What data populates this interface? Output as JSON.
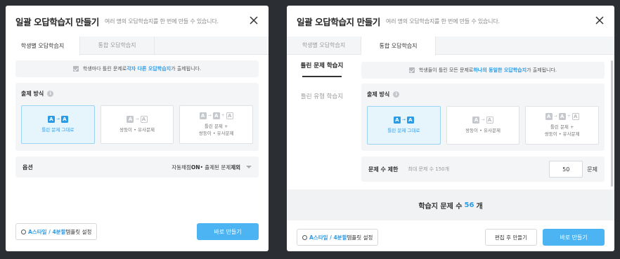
{
  "modal1": {
    "title": "일괄 오답학습지 만들기",
    "subtitle": "여러 명의 오답학습지를 한 번에 만들 수 있습니다.",
    "tabs": [
      {
        "label": "학생별 오답학습지",
        "active": true
      },
      {
        "label": "통합 오답학습지",
        "active": false
      }
    ],
    "notice": {
      "pre": "학생마다 틀린 문제로 ",
      "highlight": "각자 다른 오답학습지",
      "post": "가 출제됩니다."
    },
    "method_title": "출제 방식",
    "cards": [
      {
        "label": "틀린 문제 그대로",
        "selected": true
      },
      {
        "label": "쌍둥이 • 유사문제",
        "selected": false
      },
      {
        "label1": "틀린 문제 +",
        "label2": "쌍둥이 • 유사문제",
        "selected": false
      }
    ],
    "options": {
      "label": "옵션",
      "value_pre": "자동채점",
      "value_on": "ON",
      "value_mid": " • 출제된 문제 ",
      "value_ex": "제외"
    },
    "footer": {
      "template_a": "A스타일 / 4분할",
      "template_b": " 템플릿 설정",
      "primary": "바로 만들기"
    }
  },
  "modal2": {
    "title": "일괄 오답학습지 만들기",
    "subtitle": "여러 명의 오답학습지를 한 번에 만들 수 있습니다.",
    "tabs": [
      {
        "label": "학생별 오답학습지",
        "active": false
      },
      {
        "label": "통합 오답학습지",
        "active": true
      }
    ],
    "side": [
      {
        "label": "틀린 문제 학습지",
        "active": true
      },
      {
        "label": "틀린 유형 학습지",
        "active": false
      }
    ],
    "notice": {
      "pre": "학생들이 틀린 모든 문제로 ",
      "highlight": "하나의 동일한 오답학습지",
      "post": "가 출제됩니다."
    },
    "method_title": "출제 방식",
    "cards": [
      {
        "label": "틀린 문제 그대로",
        "selected": true
      },
      {
        "label": "쌍둥이 • 유사문제",
        "selected": false
      },
      {
        "label1": "틀린 문제 +",
        "label2": "쌍둥이 • 유사문제",
        "selected": false
      }
    ],
    "limit": {
      "label": "문제 수 제한",
      "hint": "최대 문제 수 150개",
      "value": "50",
      "unit": "문제"
    },
    "total": {
      "pre": "학습지 문제 수",
      "num": "56",
      "post": "개"
    },
    "footer": {
      "template_a": "A스타일 / 4분할",
      "template_b": " 템플릿 설정",
      "secondary": "편집 후 만들기",
      "primary": "바로 만들기"
    }
  },
  "colors": {
    "accent": "#2b9be6",
    "primary_button": "#4cb4f2",
    "selected_card_bg": "#e6f4fc"
  }
}
